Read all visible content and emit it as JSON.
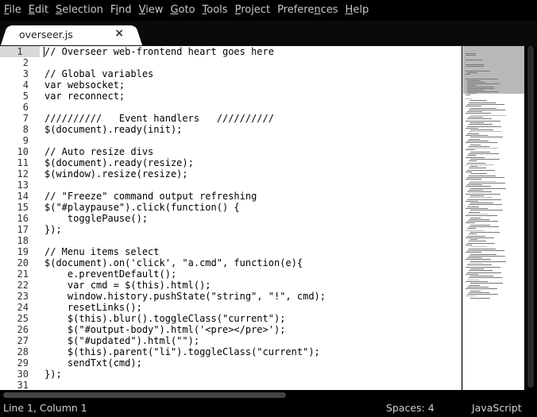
{
  "menu": [
    {
      "pre": "",
      "mn": "F",
      "post": "ile"
    },
    {
      "pre": "",
      "mn": "E",
      "post": "dit"
    },
    {
      "pre": "",
      "mn": "S",
      "post": "election"
    },
    {
      "pre": "F",
      "mn": "i",
      "post": "nd"
    },
    {
      "pre": "",
      "mn": "V",
      "post": "iew"
    },
    {
      "pre": "",
      "mn": "G",
      "post": "oto"
    },
    {
      "pre": "",
      "mn": "T",
      "post": "ools"
    },
    {
      "pre": "",
      "mn": "P",
      "post": "roject"
    },
    {
      "pre": "Prefere",
      "mn": "n",
      "post": "ces"
    },
    {
      "pre": "",
      "mn": "H",
      "post": "elp"
    }
  ],
  "tab": {
    "label": "overseer.js",
    "close": "×"
  },
  "code_lines": [
    {
      "n": "1",
      "text": "// Overseer web-frontend heart goes here",
      "comment": true
    },
    {
      "n": "2",
      "text": "",
      "comment": false
    },
    {
      "n": "3",
      "text": "// Global variables",
      "comment": true
    },
    {
      "n": "4",
      "text": "var websocket;",
      "comment": false
    },
    {
      "n": "5",
      "text": "var reconnect;",
      "comment": false
    },
    {
      "n": "6",
      "text": "",
      "comment": false
    },
    {
      "n": "7",
      "text": "//////////   Event handlers   //////////",
      "comment": true
    },
    {
      "n": "8",
      "text": "$(document).ready(init);",
      "comment": false
    },
    {
      "n": "9",
      "text": "",
      "comment": false
    },
    {
      "n": "10",
      "text": "// Auto resize divs",
      "comment": true
    },
    {
      "n": "11",
      "text": "$(document).ready(resize);",
      "comment": false
    },
    {
      "n": "12",
      "text": "$(window).resize(resize);",
      "comment": false
    },
    {
      "n": "13",
      "text": "",
      "comment": false
    },
    {
      "n": "14",
      "text": "// \"Freeze\" command output refreshing",
      "comment": true
    },
    {
      "n": "15",
      "text": "$(\"#playpause\").click(function() {",
      "comment": false
    },
    {
      "n": "16",
      "text": "    togglePause();",
      "comment": false
    },
    {
      "n": "17",
      "text": "});",
      "comment": false
    },
    {
      "n": "18",
      "text": "",
      "comment": false
    },
    {
      "n": "19",
      "text": "// Menu items select",
      "comment": true
    },
    {
      "n": "20",
      "text": "$(document).on('click', \"a.cmd\", function(e){",
      "comment": false
    },
    {
      "n": "21",
      "text": "    e.preventDefault();",
      "comment": false
    },
    {
      "n": "22",
      "text": "    var cmd = $(this).html();",
      "comment": false
    },
    {
      "n": "23",
      "text": "    window.history.pushState(\"string\", \"!\", cmd);",
      "comment": false
    },
    {
      "n": "24",
      "text": "    resetLinks();",
      "comment": false
    },
    {
      "n": "25",
      "text": "    $(this).blur().toggleClass(\"current\");",
      "comment": false
    },
    {
      "n": "26",
      "text": "    $(\"#output-body\").html('<pre></pre>');",
      "comment": false
    },
    {
      "n": "27",
      "text": "    $(\"#updated\").html(\"\");",
      "comment": false
    },
    {
      "n": "28",
      "text": "    $(this).parent(\"li\").toggleClass(\"current\");",
      "comment": false
    },
    {
      "n": "29",
      "text": "    sendTxt(cmd);",
      "comment": false
    },
    {
      "n": "30",
      "text": "});",
      "comment": false
    },
    {
      "n": "31",
      "text": "",
      "comment": false
    }
  ],
  "status": {
    "position": "Line 1, Column 1",
    "spaces": "Spaces: 4",
    "syntax": "JavaScript"
  },
  "colors": {
    "comment": "#a7a7a7",
    "code": "#000000",
    "background": "#ffffff",
    "chrome": "#000000"
  }
}
